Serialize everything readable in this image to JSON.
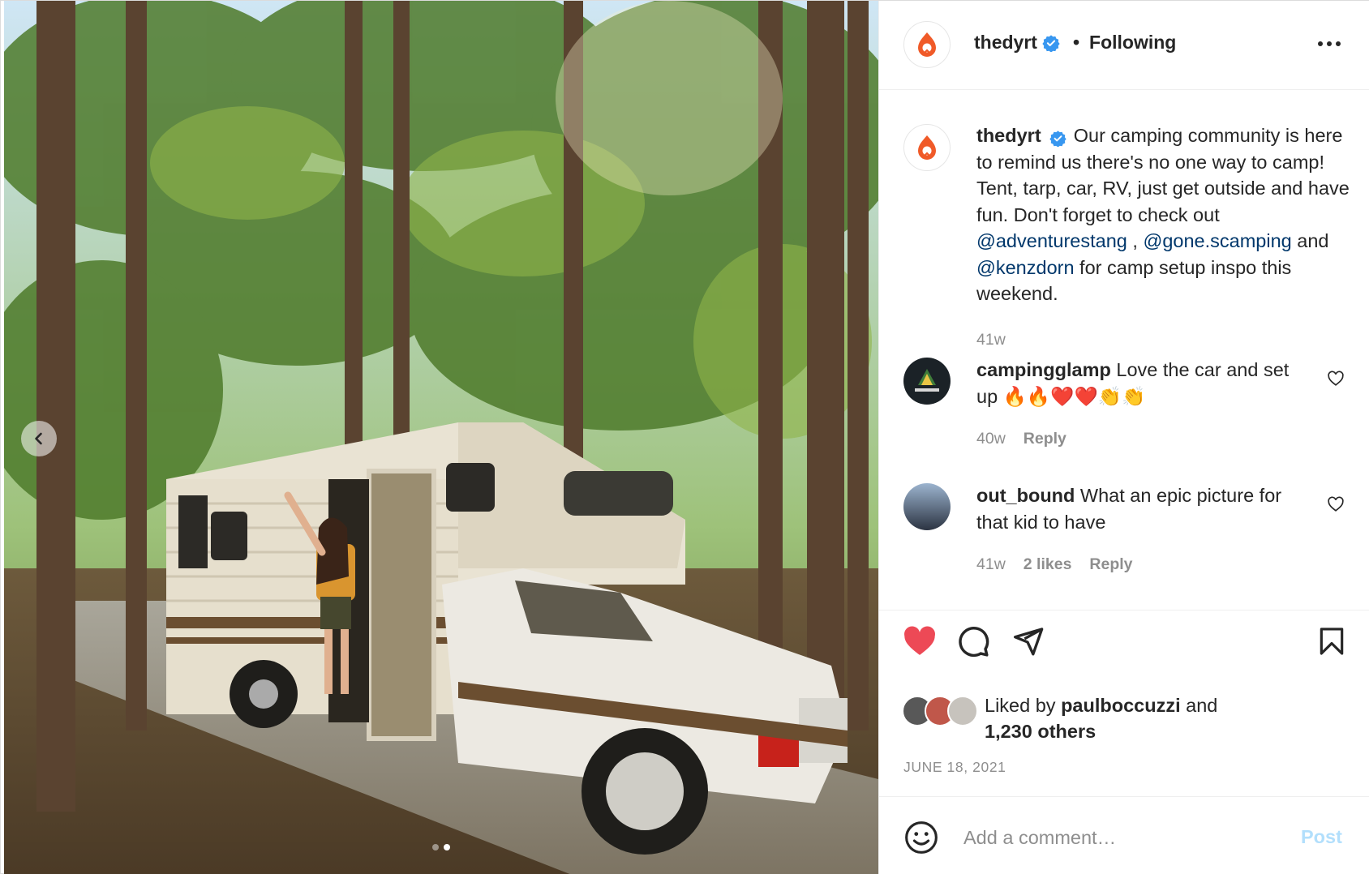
{
  "post": {
    "account": "thedyrt",
    "follow_status": "Following",
    "separator": "•"
  },
  "caption": {
    "username": "thedyrt",
    "text_1": " Our camping community is here to remind us there's no one way to camp! Tent, tarp, car, RV, just get outside and have fun. Don't forget to check out ",
    "mention_1": "@adventurestang",
    "text_2": " , ",
    "mention_2": "@gone.scamping",
    "text_3": " and ",
    "mention_3": "@kenzdorn",
    "text_4": " for camp setup inspo this weekend.",
    "time": "41w"
  },
  "comments": [
    {
      "username": "campingglamp",
      "text": " Love the car and set up 🔥🔥❤️❤️👏👏",
      "time": "40w",
      "reply_label": "Reply"
    },
    {
      "username": "out_bound",
      "text": " What an epic picture for that kid to have",
      "time": "41w",
      "likes": "2 likes",
      "reply_label": "Reply"
    }
  ],
  "likes": {
    "prefix": "Liked by ",
    "user": "paulboccuzzi",
    "suffix": " and",
    "others": "1,230 others"
  },
  "date": "JUNE 18, 2021",
  "add_comment": {
    "placeholder": "Add a comment…",
    "post_label": "Post"
  },
  "carousel": {
    "slides": 2,
    "active_index": 1
  },
  "icons": {
    "brand": "thedyrt-logo-icon",
    "verified": "verified-badge-icon",
    "like": "heart-filled-icon",
    "comment": "comment-bubble-icon",
    "share": "paper-plane-icon",
    "save": "bookmark-icon",
    "emoji": "smiley-icon"
  },
  "colors": {
    "like_red": "#ed4956",
    "verified_blue": "#3897f0",
    "mention_blue": "#00376b",
    "post_disabled": "#b2dffc",
    "brand_orange": "#f05a28"
  }
}
